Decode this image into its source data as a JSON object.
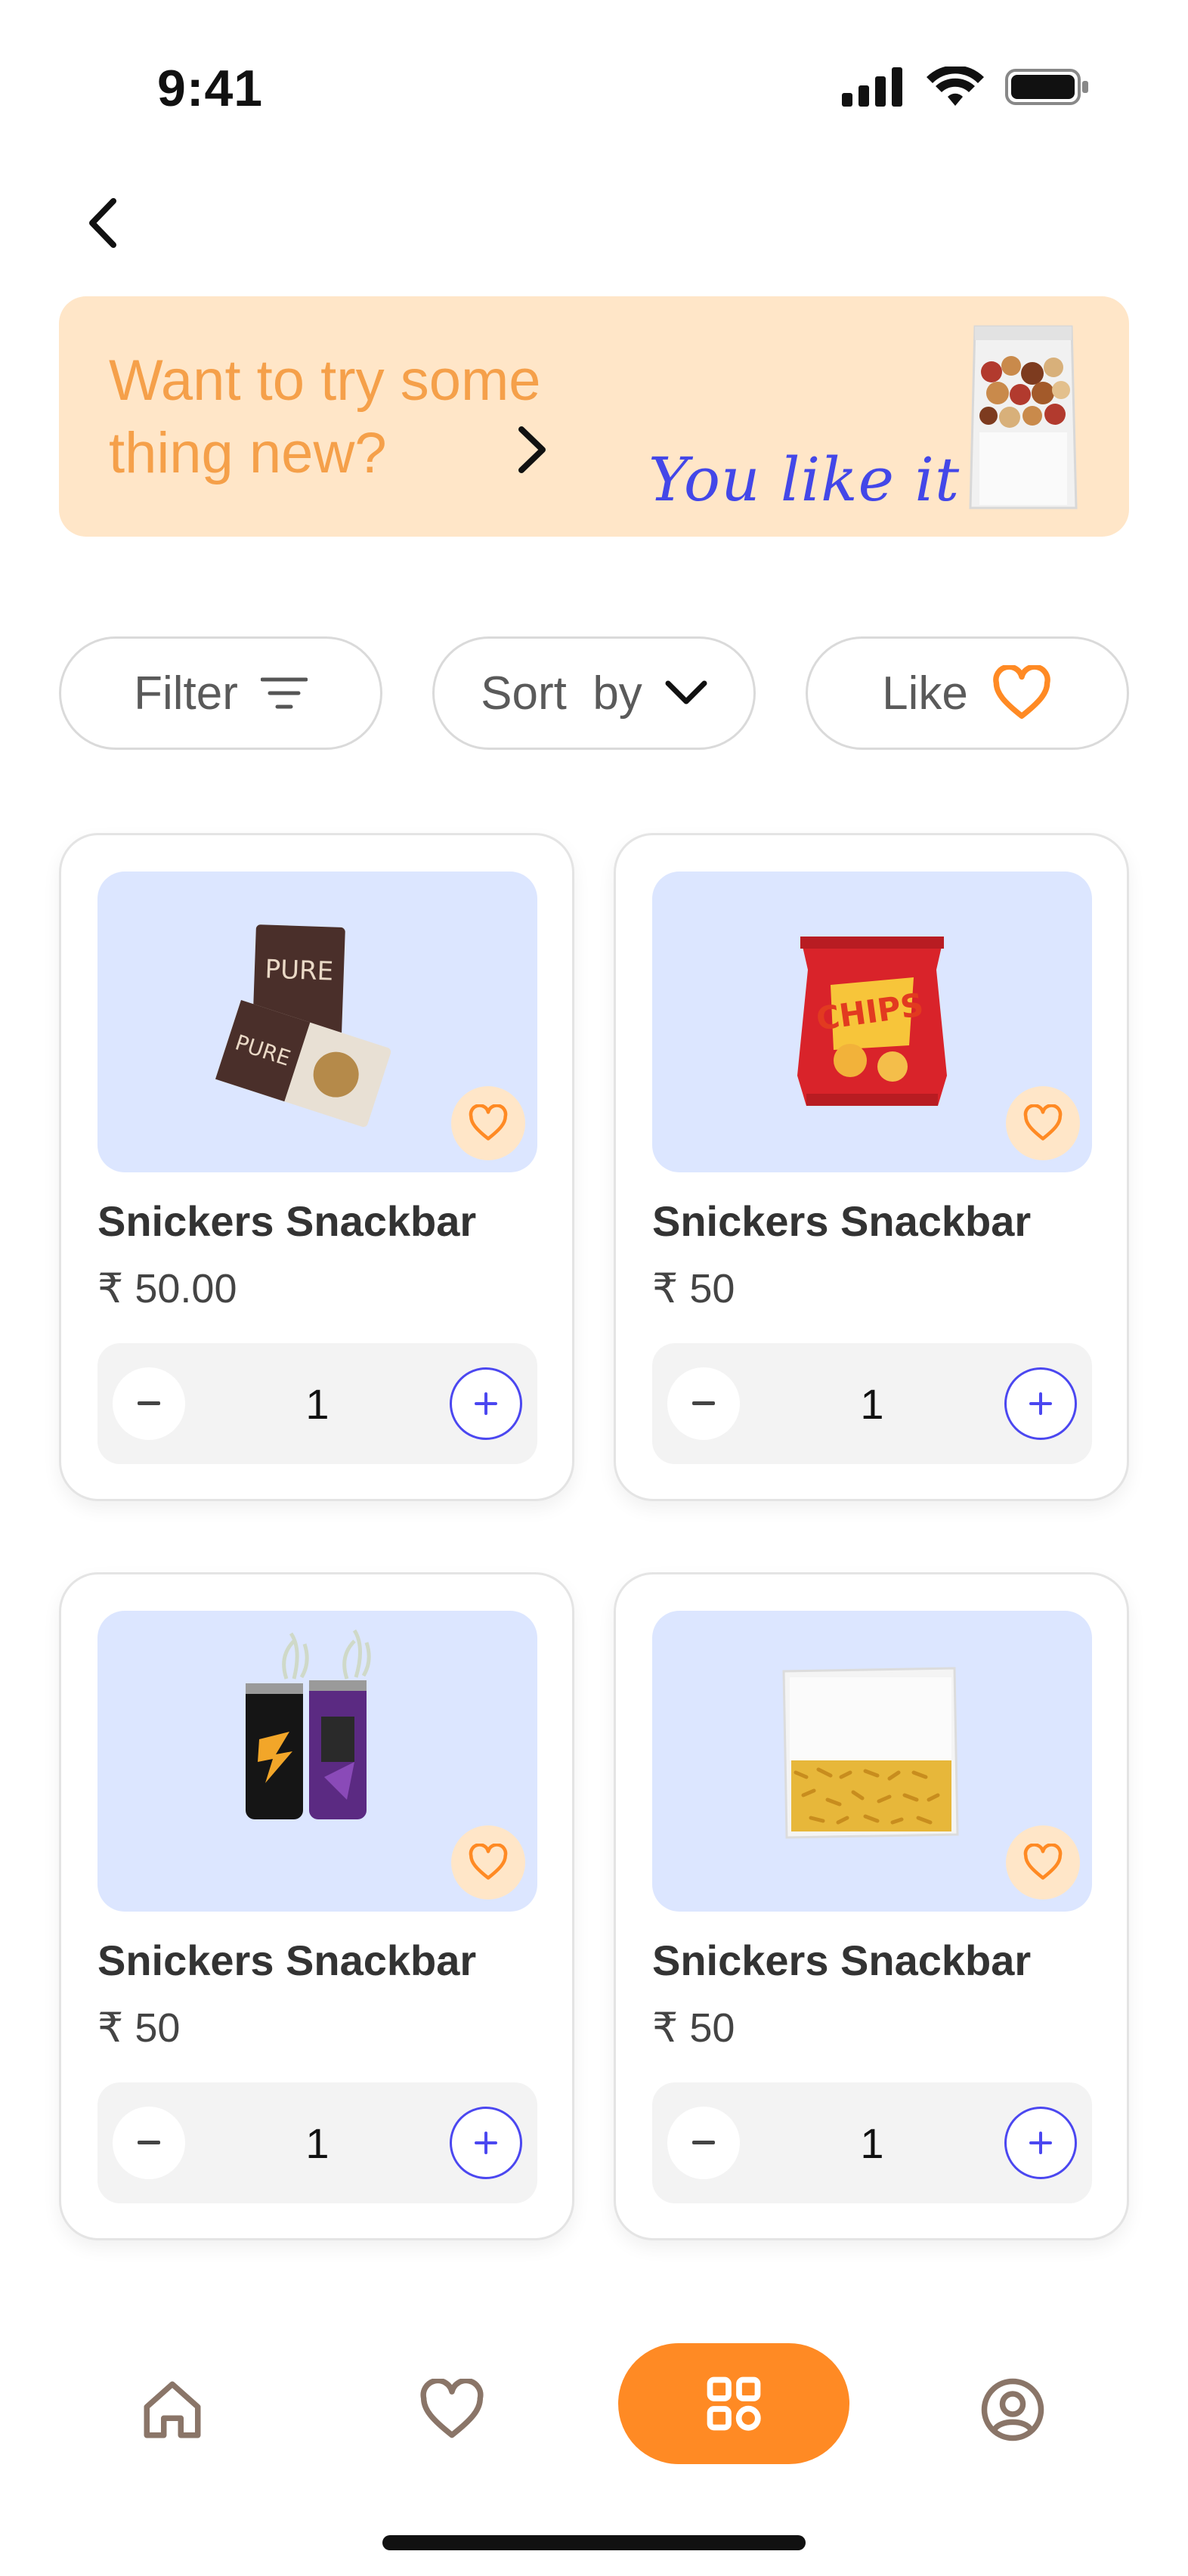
{
  "status_bar": {
    "time": "9:41"
  },
  "header": {
    "back_icon": "chevron-left-icon"
  },
  "promo": {
    "title": "Want to try some thing new?",
    "tagline": "You like it",
    "arrow_icon": "chevron-right-icon",
    "image_icon": "nuts-pouch-image"
  },
  "chips": {
    "filter_label": "Filter",
    "sort_label": "Sort  by",
    "like_label": "Like"
  },
  "products": [
    {
      "name": "Snickers Snackbar",
      "price": "₹ 50.00",
      "qty": "1",
      "image": "chocolate-bars-image"
    },
    {
      "name": "Snickers Snackbar",
      "price": "₹ 50",
      "qty": "1",
      "image": "chips-bag-image"
    },
    {
      "name": "Snickers Snackbar",
      "price": "₹ 50",
      "qty": "1",
      "image": "energy-drink-cans-image"
    },
    {
      "name": "Snickers Snackbar",
      "price": "₹ 50",
      "qty": "1",
      "image": "namkeen-packet-image"
    }
  ],
  "nav": {
    "items": [
      "home-icon",
      "heart-icon",
      "categories-icon",
      "profile-icon"
    ],
    "active": "categories-icon"
  },
  "colors": {
    "accent": "#ff8a24",
    "banner_bg": "#ffe6c8",
    "promo_text": "#f5a04a",
    "tagline": "#4347e8",
    "card_image_bg": "#dce6ff",
    "plus_border": "#4b47f0"
  }
}
